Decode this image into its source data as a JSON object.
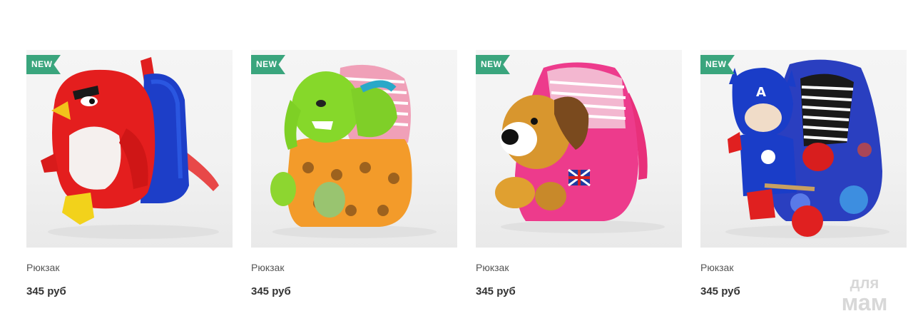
{
  "products": [
    {
      "badge": "NEW",
      "title": "Рюкзак",
      "price": "345 руб",
      "image": "angry-bird-plush-backpack"
    },
    {
      "badge": "NEW",
      "title": "Рюкзак",
      "price": "345 руб",
      "image": "green-elephant-plush-backpack"
    },
    {
      "badge": "NEW",
      "title": "Рюкзак",
      "price": "345 руб",
      "image": "puppy-plush-pink-backpack"
    },
    {
      "badge": "NEW",
      "title": "Рюкзак",
      "price": "345 руб",
      "image": "captain-hero-plush-backpack"
    }
  ],
  "watermark": {
    "line1": "для",
    "line2": "мам"
  },
  "colors": {
    "badge": "#3aa57d",
    "title": "#555555",
    "price": "#333333"
  }
}
